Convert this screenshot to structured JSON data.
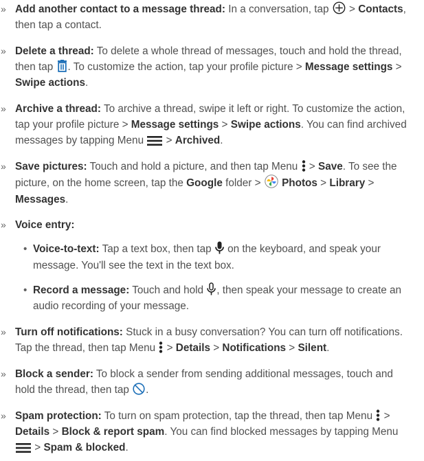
{
  "marker": "»",
  "bullet": "•",
  "colors": {
    "icon_blue": "#1c6fb8",
    "text": "#505050",
    "bold": "#333333"
  },
  "items": [
    {
      "title": "Add another contact to a message thread:",
      "t1": " In a conversation, tap ",
      "t2": " > ",
      "b1": "Contacts",
      "t3": ", then tap a contact.",
      "icon": "add-circle-icon"
    },
    {
      "title": "Delete a thread:",
      "t1": " To delete a whole thread of messages, touch and hold the thread, then tap ",
      "t2": ". To customize the action, tap your profile picture > ",
      "b1": "Message settings",
      "t3": " > ",
      "b2": "Swipe actions",
      "t4": ".",
      "icon": "trash-icon"
    },
    {
      "title": "Archive a thread:",
      "t1": " To archive a thread, swipe it left or right. To customize the action, tap your profile picture > ",
      "b1": "Message settings",
      "t2": " > ",
      "b2": "Swipe actions",
      "t3": ". You can find archived messages by tapping Menu ",
      "t4": " > ",
      "b3": "Archived",
      "t5": ".",
      "icon": "hamburger-menu-icon"
    },
    {
      "title": "Save pictures:",
      "t1": " Touch and hold a picture, and then tap Menu ",
      "t2": " > ",
      "b1": "Save",
      "t3": ". To see the picture, on the home screen, tap the ",
      "b2": "Google",
      "t4": " folder > ",
      "b3": "Photos",
      "t5": " > ",
      "b4": "Library",
      "t6": " > ",
      "b5": "Messages",
      "t7": ".",
      "icons": [
        "more-vertical-icon",
        "google-photos-icon"
      ]
    },
    {
      "title": "Voice entry:",
      "subs": [
        {
          "title": "Voice-to-text:",
          "t1": " Tap a text box, then tap ",
          "t2": " on the keyboard, and speak your message. You'll see the text in the text box.",
          "icon": "microphone-icon"
        },
        {
          "title": "Record a message:",
          "t1": " Touch and hold ",
          "t2": ", then speak your message to create an audio recording of your message.",
          "icon": "microphone-outline-icon"
        }
      ]
    },
    {
      "title": "Turn off notifications:",
      "t1": " Stuck in a busy conversation? You can turn off notifications. Tap the thread, then tap Menu ",
      "t2": " > ",
      "b1": "Details",
      "t3": " > ",
      "b2": "Notifications",
      "t4": " > ",
      "b3": "Silent",
      "t5": ".",
      "icon": "more-vertical-icon"
    },
    {
      "title": "Block a sender:",
      "t1": " To block a sender from sending additional messages, touch and hold the thread, then tap ",
      "t2": ".",
      "icon": "block-icon"
    },
    {
      "title": "Spam protection:",
      "t1": " To turn on spam protection, tap the thread, then tap Menu ",
      "t2": " > ",
      "b1": "Details",
      "t3": " > ",
      "b2": "Block & report spam",
      "t4": ". You can find blocked messages by tapping Menu ",
      "t5": " > ",
      "b3": "Spam & blocked",
      "t6": ".",
      "icons": [
        "more-vertical-icon",
        "hamburger-menu-icon"
      ]
    }
  ]
}
